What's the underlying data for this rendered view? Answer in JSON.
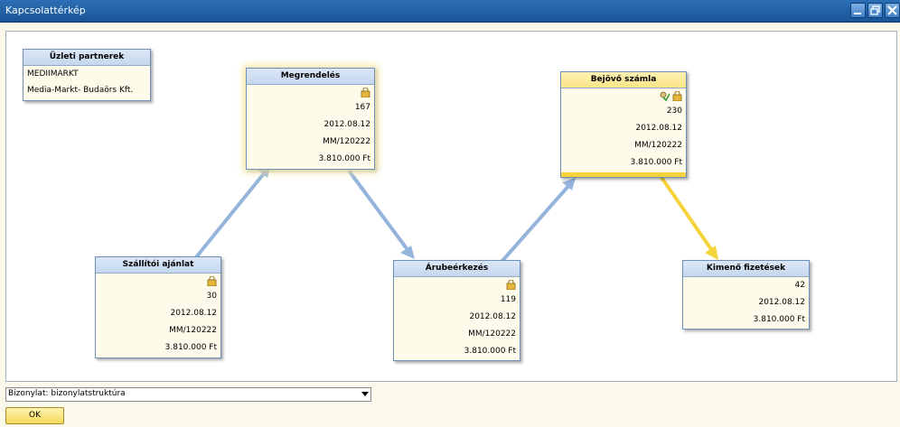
{
  "window": {
    "title": "Kapcsolattérkép"
  },
  "partner": {
    "header": "Üzleti partnerek",
    "code": "MEDIIMARKT",
    "name": "Media-Markt- Budaörs Kft."
  },
  "nodes": {
    "szallitoi": {
      "header": "Szállítói ajánlat",
      "number": "30",
      "date": "2012.08.12",
      "ref": "MM/120222",
      "amount": "3.810.000 Ft"
    },
    "megrendeles": {
      "header": "Megrendelés",
      "number": "167",
      "date": "2012.08.12",
      "ref": "MM/120222",
      "amount": "3.810.000 Ft"
    },
    "arubeerkezes": {
      "header": "Árubeérkezés",
      "number": "119",
      "date": "2012.08.12",
      "ref": "MM/120222",
      "amount": "3.810.000 Ft"
    },
    "bejovo": {
      "header": "Bejövő számla",
      "number": "230",
      "date": "2012.08.12",
      "ref": "MM/120222",
      "amount": "3.810.000 Ft"
    },
    "kimeno": {
      "header": "Kimenő fizetések",
      "number": "42",
      "date": "2012.08.12",
      "amount": "3.810.000 Ft"
    }
  },
  "footer": {
    "combo_value": "Bizonylat: bizonylatstruktúra",
    "ok_label": "OK"
  },
  "colors": {
    "arrow": "#94b4dc",
    "arrow_highlight": "#f5d33a"
  },
  "icons": [
    "lock-icon",
    "approval-check-icon",
    "chevron-down-icon",
    "minimize-icon",
    "restore-icon",
    "close-icon"
  ]
}
